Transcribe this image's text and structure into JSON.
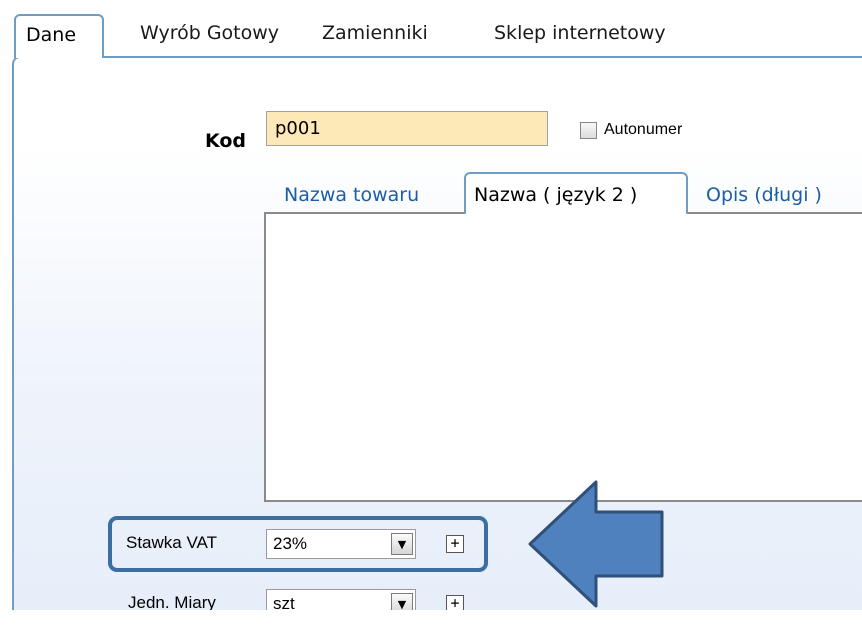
{
  "tabs": [
    {
      "label": "Dane",
      "active": true
    },
    {
      "label": "Wyrób Gotowy",
      "active": false
    },
    {
      "label": "Zamienniki",
      "active": false
    },
    {
      "label": "Sklep internetowy",
      "active": false
    }
  ],
  "kod": {
    "label": "Kod",
    "value": "p001"
  },
  "autonumer": {
    "label": "Autonumer",
    "checked": false
  },
  "name_tabs": [
    {
      "label": "Nazwa towaru",
      "active": false
    },
    {
      "label": "Nazwa ( język 2 )",
      "active": true
    },
    {
      "label": "Opis (długi )",
      "active": false
    }
  ],
  "name_text": "",
  "vat": {
    "label": "Stawka VAT",
    "value": "23%"
  },
  "unit": {
    "label": "Jedn. Miary",
    "value": "szt"
  },
  "colors": {
    "tab_border": "#6f9cc4",
    "kod_background": "#fde8b8",
    "link_text": "#1c5ea6",
    "highlight": "#3c6ea2",
    "arrow_fill": "#4e81bd",
    "arrow_stroke": "#2f5079"
  },
  "icons": {
    "dropdown": "chevron-down-icon",
    "add": "plus-icon",
    "annotation": "arrow-left-icon"
  }
}
